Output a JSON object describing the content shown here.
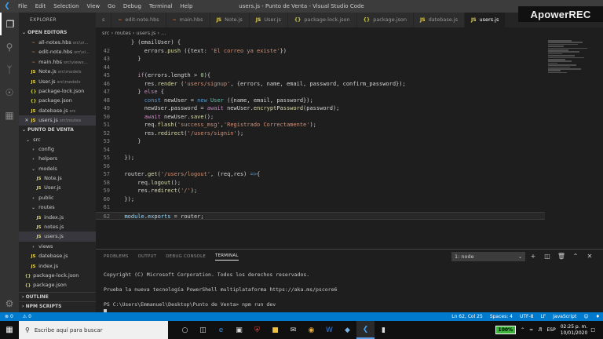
{
  "window": {
    "title": "users.js - Punto de Venta - Visual Studio Code",
    "menu": [
      "File",
      "Edit",
      "Selection",
      "View",
      "Go",
      "Debug",
      "Terminal",
      "Help"
    ]
  },
  "watermark": "ApowerREC",
  "sidebar": {
    "header": "EXPLORER",
    "open_editors_label": "OPEN EDITORS",
    "open_editors": [
      {
        "icon": "hbs",
        "name": "all-notes.hbs",
        "hint": "src\\vi..."
      },
      {
        "icon": "hbs",
        "name": "edit-note.hbs",
        "hint": "src\\vi..."
      },
      {
        "icon": "hbs",
        "name": "main.hbs",
        "hint": "src\\views..."
      },
      {
        "icon": "js",
        "name": "Note.js",
        "hint": "src\\models"
      },
      {
        "icon": "js",
        "name": "User.js",
        "hint": "src\\models"
      },
      {
        "icon": "json",
        "name": "package-lock.json",
        "hint": ""
      },
      {
        "icon": "json",
        "name": "package.json",
        "hint": ""
      },
      {
        "icon": "js",
        "name": "datebase.js",
        "hint": "src"
      },
      {
        "icon": "js",
        "name": "users.js",
        "hint": "src\\routes"
      }
    ],
    "project_label": "PUNTO DE VENTA",
    "tree": [
      {
        "indent": 1,
        "type": "folder-open",
        "name": "src"
      },
      {
        "indent": 2,
        "type": "folder",
        "name": "config"
      },
      {
        "indent": 2,
        "type": "folder",
        "name": "helpers"
      },
      {
        "indent": 2,
        "type": "folder-open",
        "name": "models"
      },
      {
        "indent": 3,
        "type": "js",
        "name": "Note.js"
      },
      {
        "indent": 3,
        "type": "js",
        "name": "User.js"
      },
      {
        "indent": 2,
        "type": "folder",
        "name": "public"
      },
      {
        "indent": 2,
        "type": "folder-open",
        "name": "routes"
      },
      {
        "indent": 3,
        "type": "js",
        "name": "index.js"
      },
      {
        "indent": 3,
        "type": "js",
        "name": "notes.js"
      },
      {
        "indent": 3,
        "type": "js",
        "name": "users.js"
      },
      {
        "indent": 2,
        "type": "folder",
        "name": "views"
      },
      {
        "indent": 2,
        "type": "js",
        "name": "datebase.js"
      },
      {
        "indent": 2,
        "type": "js",
        "name": "index.js"
      },
      {
        "indent": 1,
        "type": "json",
        "name": "package-lock.json"
      },
      {
        "indent": 1,
        "type": "json",
        "name": "package.json"
      }
    ],
    "outline_label": "OUTLINE",
    "npm_label": "NPM SCRIPTS"
  },
  "tabs": [
    {
      "icon": "hbs",
      "label": "s"
    },
    {
      "icon": "hbs",
      "label": "edit-note.hbs"
    },
    {
      "icon": "hbs",
      "label": "main.hbs"
    },
    {
      "icon": "js",
      "label": "Note.js"
    },
    {
      "icon": "js",
      "label": "User.js"
    },
    {
      "icon": "json",
      "label": "package-lock.json"
    },
    {
      "icon": "json",
      "label": "package.json"
    },
    {
      "icon": "js",
      "label": "datebase.js"
    },
    {
      "icon": "js",
      "label": "users.js"
    }
  ],
  "breadcrumb": [
    "src",
    "routes",
    "users.js",
    "..."
  ],
  "editor": {
    "current_line": "62",
    "lines": [
      {
        "n": "",
        "t": [
          [
            "    ",
            ""
          ],
          [
            "} (emailUser) {",
            "code"
          ]
        ]
      },
      {
        "n": "42",
        "t": [
          [
            "        errors.",
            ""
          ],
          [
            "push",
            "fn"
          ],
          [
            " ({text: ",
            ""
          ],
          [
            "'El correo ya existe'",
            "str"
          ],
          [
            "})",
            ""
          ]
        ]
      },
      {
        "n": "43",
        "t": [
          [
            "      }",
            ""
          ]
        ]
      },
      {
        "n": "44",
        "t": [
          [
            "",
            ""
          ]
        ]
      },
      {
        "n": "45",
        "t": [
          [
            "      ",
            ""
          ],
          [
            "if",
            "kw"
          ],
          [
            "(errors.length > ",
            ""
          ],
          [
            "0",
            "num"
          ],
          [
            "){",
            ""
          ]
        ]
      },
      {
        "n": "46",
        "t": [
          [
            "        res.",
            ""
          ],
          [
            "render",
            "fn"
          ],
          [
            " (",
            ""
          ],
          [
            "'users/signup'",
            "str"
          ],
          [
            ", {errors, name, email, password, confirm_password});",
            ""
          ]
        ]
      },
      {
        "n": "47",
        "t": [
          [
            "      } ",
            ""
          ],
          [
            "else",
            "kw"
          ],
          [
            " {",
            ""
          ]
        ]
      },
      {
        "n": "48",
        "t": [
          [
            "        ",
            ""
          ],
          [
            "const",
            "kw2"
          ],
          [
            " newUser = ",
            ""
          ],
          [
            "new",
            "kw2"
          ],
          [
            " ",
            ""
          ],
          [
            "User",
            "cls"
          ],
          [
            " ({name, email, password});",
            ""
          ]
        ]
      },
      {
        "n": "49",
        "t": [
          [
            "        newUser.password = ",
            ""
          ],
          [
            "await",
            "kw"
          ],
          [
            " newUser.",
            ""
          ],
          [
            "encryptPassword",
            "fn"
          ],
          [
            "(password);",
            ""
          ]
        ]
      },
      {
        "n": "50",
        "t": [
          [
            "        ",
            ""
          ],
          [
            "await",
            "kw"
          ],
          [
            " newUser.",
            ""
          ],
          [
            "save",
            "fn"
          ],
          [
            "();",
            ""
          ]
        ]
      },
      {
        "n": "51",
        "t": [
          [
            "        req.",
            ""
          ],
          [
            "flash",
            "fn"
          ],
          [
            "(",
            ""
          ],
          [
            "'success_msg'",
            "str"
          ],
          [
            ",",
            ""
          ],
          [
            "'Registrado Correctamente'",
            "str"
          ],
          [
            ");",
            ""
          ]
        ]
      },
      {
        "n": "52",
        "t": [
          [
            "        res.",
            ""
          ],
          [
            "redirect",
            "fn"
          ],
          [
            "(",
            ""
          ],
          [
            "'/users/signin'",
            "str"
          ],
          [
            ");",
            ""
          ]
        ]
      },
      {
        "n": "53",
        "t": [
          [
            "      }",
            ""
          ]
        ]
      },
      {
        "n": "54",
        "t": [
          [
            "",
            ""
          ]
        ]
      },
      {
        "n": "55",
        "t": [
          [
            "  });",
            ""
          ]
        ]
      },
      {
        "n": "56",
        "t": [
          [
            "",
            ""
          ]
        ]
      },
      {
        "n": "57",
        "t": [
          [
            "  router.",
            ""
          ],
          [
            "get",
            "fn"
          ],
          [
            "(",
            ""
          ],
          [
            "'/users/logout'",
            "str"
          ],
          [
            ", (req,res) ",
            ""
          ],
          [
            "=>",
            "kw2"
          ],
          [
            "{",
            ""
          ]
        ]
      },
      {
        "n": "58",
        "t": [
          [
            "      req.",
            ""
          ],
          [
            "logout",
            "fn"
          ],
          [
            "();",
            ""
          ]
        ]
      },
      {
        "n": "59",
        "t": [
          [
            "      res.",
            ""
          ],
          [
            "redirect",
            "fn"
          ],
          [
            "(",
            ""
          ],
          [
            "'/'",
            "str"
          ],
          [
            ");",
            ""
          ]
        ]
      },
      {
        "n": "60",
        "t": [
          [
            "  });",
            ""
          ]
        ]
      },
      {
        "n": "61",
        "t": [
          [
            "",
            ""
          ]
        ]
      },
      {
        "n": "62",
        "t": [
          [
            "  ",
            ""
          ],
          [
            "module",
            "var"
          ],
          [
            ".",
            ""
          ],
          [
            "exports",
            "var"
          ],
          [
            " = router;",
            ""
          ]
        ]
      }
    ]
  },
  "panel": {
    "tabs": [
      "PROBLEMS",
      "OUTPUT",
      "DEBUG CONSOLE",
      "TERMINAL"
    ],
    "active_tab": "TERMINAL",
    "terminal_select": "1: node",
    "terminal_lines": [
      "",
      "Copyright (C) Microsoft Corporation. Todos los derechos reservados.",
      "",
      "Prueba la nueva tecnología PowerShell multiplataforma https://aka.ms/pscore6",
      "",
      "PS C:\\Users\\Emmanuel\\Desktop\\Punto de Venta> npm run dev"
    ]
  },
  "status": {
    "errors": "0",
    "warnings": "0",
    "position": "Ln 62, Col 25",
    "spaces": "Spaces: 4",
    "encoding": "UTF-8",
    "eol": "LF",
    "language": "JavaScript"
  },
  "taskbar": {
    "search_placeholder": "Escribe aquí para buscar",
    "battery": "100%",
    "lang": "ESP",
    "time": "02:25 p. m.",
    "date": "10/01/2020"
  },
  "colors": {
    "accent": "#007acc",
    "activity_bar": "#333333",
    "sidebar": "#252526",
    "editor_bg": "#1e1e1e"
  }
}
